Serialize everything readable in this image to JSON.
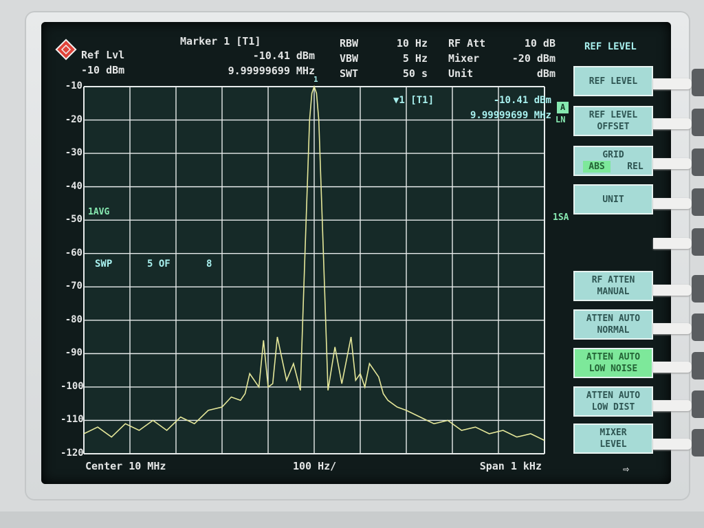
{
  "header": {
    "ref_lvl_label": "Ref Lvl",
    "ref_lvl_value": "-10 dBm",
    "marker_title": "Marker 1 [T1]",
    "marker_level": "-10.41 dBm",
    "marker_freq": "9.99999699 MHz",
    "rbw_label": "RBW",
    "rbw_value": "10 Hz",
    "vbw_label": "VBW",
    "vbw_value": "5 Hz",
    "swt_label": "SWT",
    "swt_value": "50 s",
    "rfatt_label": "RF Att",
    "rfatt_value": "10 dB",
    "mixer_label": "Mixer",
    "mixer_value": "-20 dBm",
    "unit_label": "Unit",
    "unit_value": "dBm",
    "menu_title": "REF LEVEL"
  },
  "trace_info": {
    "marker_box_label": "▼1 [T1]",
    "marker_box_level": "-10.41 dBm",
    "marker_box_freq": "9.99999699 MHz",
    "badge_a": "A",
    "badge_lm": "LN",
    "avg_label": "1AVG",
    "sa_label": "1SA",
    "sweep_label": "SWP",
    "sweep_count": "5 OF",
    "sweep_total": "8",
    "marker_flag": "1"
  },
  "footer": {
    "center": "Center 10 MHz",
    "div": "100 Hz/",
    "span": "Span 1 kHz",
    "arrow": "⇨"
  },
  "softkeys": [
    {
      "line1": "REF LEVEL",
      "line2": "",
      "active": false
    },
    {
      "line1": "REF LEVEL",
      "line2": "OFFSET",
      "active": false
    },
    {
      "line1": "GRID",
      "line2": "",
      "abs": "ABS",
      "rel": "REL",
      "active": false
    },
    {
      "line1": "UNIT",
      "line2": "",
      "active": false
    },
    {
      "line1": "RF ATTEN",
      "line2": "MANUAL",
      "active": false
    },
    {
      "line1": "ATTEN AUTO",
      "line2": "NORMAL",
      "active": false
    },
    {
      "line1": "ATTEN AUTO",
      "line2": "LOW NOISE",
      "active": true
    },
    {
      "line1": "ATTEN AUTO",
      "line2": "LOW DIST",
      "active": false
    },
    {
      "line1": "MIXER",
      "line2": "LEVEL",
      "active": false
    }
  ],
  "colors": {
    "trace": "#e6e89a",
    "grid": "#e8ecec",
    "screen_bg": "#101b1b",
    "softkey": "#a6dbd6",
    "softkey_active": "#7de89a"
  },
  "chart_data": {
    "type": "line",
    "title": "",
    "xlabel": "",
    "ylabel": "",
    "y_tick_labels": [
      "-10",
      "-20",
      "-30",
      "-40",
      "-50",
      "-60",
      "-70",
      "-80",
      "-90",
      "-100",
      "-110",
      "-120"
    ],
    "xlim_hz": [
      9999500,
      10000500
    ],
    "ylim": [
      -120,
      -10
    ],
    "grid": true,
    "series": [
      {
        "x_offset_hz_from_center": [
          -500,
          -470,
          -440,
          -410,
          -380,
          -350,
          -320,
          -290,
          -260,
          -230,
          -200,
          -180,
          -160,
          -150,
          -140,
          -120,
          -110,
          -100,
          -90,
          -80,
          -60,
          -45,
          -30,
          -20,
          -10,
          -5,
          0,
          5,
          10,
          20,
          30,
          45,
          60,
          80,
          90,
          100,
          110,
          120,
          140,
          150,
          160,
          180,
          200,
          230,
          260,
          290,
          320,
          350,
          380,
          410,
          440,
          470,
          500
        ],
        "y_dbm": [
          -114,
          -112,
          -115,
          -111,
          -113,
          -110,
          -113,
          -109,
          -111,
          -107,
          -106,
          -103,
          -104,
          -102,
          -96,
          -100,
          -86,
          -100,
          -99,
          -85,
          -98,
          -93,
          -101,
          -60,
          -20,
          -12,
          -10,
          -12,
          -20,
          -60,
          -101,
          -88,
          -99,
          -85,
          -98,
          -96,
          -100,
          -93,
          -97,
          -102,
          -104,
          -106,
          -107,
          -109,
          -111,
          -110,
          -113,
          -112,
          -114,
          -113,
          -115,
          -114,
          -116
        ]
      }
    ]
  }
}
